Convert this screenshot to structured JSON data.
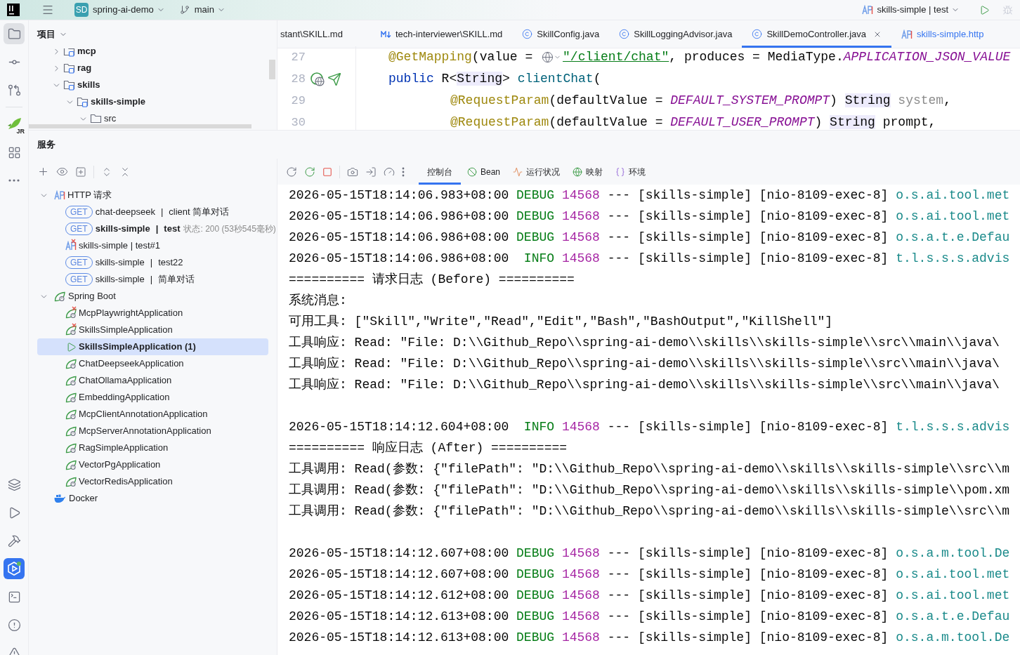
{
  "title_bar": {
    "project_badge": "SD",
    "project": "spring-ai-demo",
    "branch": "main",
    "run_config": "skills-simple | test"
  },
  "rail": {
    "top": [
      {
        "kind": "folder",
        "selected": true
      },
      {
        "kind": "commit",
        "selected": false
      },
      {
        "kind": "pull-request",
        "selected": false
      },
      {
        "kind": "rocket",
        "badge": "JR",
        "selected": false
      },
      {
        "kind": "structure",
        "selected": false
      },
      {
        "kind": "more",
        "selected": false
      }
    ],
    "bottom": [
      {
        "kind": "layers",
        "selected": false
      },
      {
        "kind": "run",
        "selected": false
      },
      {
        "kind": "build",
        "selected": false
      },
      {
        "kind": "services",
        "selected": true
      },
      {
        "kind": "terminal",
        "selected": false
      },
      {
        "kind": "problems",
        "selected": false
      },
      {
        "kind": "warning",
        "selected": false
      }
    ]
  },
  "project_panel": {
    "title": "项目",
    "tree": [
      {
        "label": "mcp",
        "kind": "module",
        "expanded": false
      },
      {
        "label": "rag",
        "kind": "module",
        "expanded": false
      },
      {
        "label": "skills",
        "kind": "module",
        "expanded": true,
        "children": [
          {
            "label": "skills-simple",
            "kind": "module",
            "expanded": true,
            "children": [
              {
                "label": "src",
                "kind": "folder",
                "expanded": true
              }
            ]
          }
        ]
      }
    ]
  },
  "editor": {
    "tabs": [
      {
        "label": "stant\\SKILL.md",
        "kind": "cut",
        "selected": false
      },
      {
        "label": "tech-interviewer\\SKILL.md",
        "kind": "markdown",
        "selected": false
      },
      {
        "label": "SkillConfig.java",
        "kind": "java",
        "selected": false
      },
      {
        "label": "SkillLoggingAdvisor.java",
        "kind": "java",
        "selected": false
      },
      {
        "label": "SkillDemoController.java",
        "kind": "java",
        "selected": true
      },
      {
        "label": "skills-simple.http",
        "kind": "http",
        "selected": false
      }
    ],
    "lines": [
      {
        "number": "27",
        "kind": "statement",
        "endpoint": false,
        "segments": [
          {
            "kind": "annotation",
            "text": "@GetMapping"
          },
          {
            "kind": "plain",
            "text": "(value = "
          },
          {
            "kind": "globe"
          },
          {
            "kind": "url",
            "text": "\"/client/chat\""
          },
          {
            "kind": "plain",
            "text": ", produces = MediaType."
          },
          {
            "kind": "constant",
            "text": "APPLICATION_JSON_VALUE"
          }
        ]
      },
      {
        "number": "28",
        "kind": "statement",
        "endpoint": true,
        "segments": [
          {
            "kind": "keyword",
            "text": "public"
          },
          {
            "kind": "plain",
            "text": " R<"
          },
          {
            "kind": "type",
            "text": "String"
          },
          {
            "kind": "plain",
            "text": "> "
          },
          {
            "kind": "function",
            "text": "clientChat"
          },
          {
            "kind": "plain",
            "text": "("
          }
        ]
      },
      {
        "number": "29",
        "kind": "continuation",
        "endpoint": false,
        "segments": [
          {
            "kind": "annotation",
            "text": "@RequestParam"
          },
          {
            "kind": "plain",
            "text": "(defaultValue = "
          },
          {
            "kind": "constant",
            "text": "DEFAULT_SYSTEM_PROMPT"
          },
          {
            "kind": "plain",
            "text": ") "
          },
          {
            "kind": "type",
            "text": "String"
          },
          {
            "kind": "param",
            "text": " system"
          },
          {
            "kind": "plain",
            "text": ","
          }
        ]
      },
      {
        "number": "30",
        "kind": "continuation",
        "endpoint": false,
        "segments": [
          {
            "kind": "annotation",
            "text": "@RequestParam"
          },
          {
            "kind": "plain",
            "text": "(defaultValue = "
          },
          {
            "kind": "constant",
            "text": "DEFAULT_USER_PROMPT"
          },
          {
            "kind": "plain",
            "text": ") "
          },
          {
            "kind": "type",
            "text": "String"
          },
          {
            "kind": "plain",
            "text": " prompt,"
          }
        ]
      }
    ]
  },
  "services": {
    "title": "服务",
    "tree": [
      {
        "kind": "http-group",
        "label": "HTTP 请求",
        "expanded": true,
        "selected": false,
        "children": [
          {
            "kind": "request",
            "method": "GET",
            "name": "chat-deepseek",
            "separator": "|",
            "desc": "client 简单对话",
            "bold": false,
            "selected": false
          },
          {
            "kind": "request",
            "method": "GET",
            "name": "skills-simple",
            "separator": "|",
            "desc": "test",
            "status": "状态: 200 (53秒545毫秒)",
            "bold": true,
            "selected": false
          },
          {
            "kind": "failed-request",
            "label": "skills-simple | test#1",
            "selected": false
          },
          {
            "kind": "request",
            "method": "GET",
            "name": "skills-simple",
            "separator": "|",
            "desc": "test22",
            "bold": false,
            "selected": false
          },
          {
            "kind": "request",
            "method": "GET",
            "name": "skills-simple",
            "separator": "|",
            "desc": "简单对话",
            "bold": false,
            "selected": false
          }
        ]
      },
      {
        "kind": "spring-group",
        "label": "Spring Boot",
        "expanded": true,
        "selected": false,
        "children": [
          {
            "kind": "app",
            "label": "McpPlaywrightApplication",
            "error": true,
            "running": false,
            "selected": false
          },
          {
            "kind": "app",
            "label": "SkillsSimpleApplication",
            "error": true,
            "running": false,
            "selected": false
          },
          {
            "kind": "app",
            "label": "SkillsSimpleApplication (1)",
            "error": false,
            "running": true,
            "selected": true
          },
          {
            "kind": "app",
            "label": "ChatDeepseekApplication",
            "error": false,
            "running": false,
            "selected": false
          },
          {
            "kind": "app",
            "label": "ChatOllamaApplication",
            "error": false,
            "running": false,
            "selected": false
          },
          {
            "kind": "app",
            "label": "EmbeddingApplication",
            "error": false,
            "running": false,
            "selected": false
          },
          {
            "kind": "app",
            "label": "McpClientAnnotationApplication",
            "error": false,
            "running": false,
            "selected": false
          },
          {
            "kind": "app",
            "label": "McpServerAnnotationApplication",
            "error": false,
            "running": false,
            "selected": false
          },
          {
            "kind": "app",
            "label": "RagSimpleApplication",
            "error": false,
            "running": false,
            "selected": false
          },
          {
            "kind": "app",
            "label": "VectorPgApplication",
            "error": false,
            "running": false,
            "selected": false
          },
          {
            "kind": "app",
            "label": "VectorRedisApplication",
            "error": false,
            "running": false,
            "selected": false
          }
        ]
      },
      {
        "kind": "docker",
        "label": "Docker",
        "selected": false
      }
    ],
    "console_tabs": [
      {
        "label": "控制台",
        "kind": "console",
        "selected": true
      },
      {
        "label": "Bean",
        "kind": "bean",
        "selected": false
      },
      {
        "label": "运行状况",
        "kind": "health",
        "selected": false
      },
      {
        "label": "映射",
        "kind": "mapping",
        "selected": false
      },
      {
        "label": "环境",
        "kind": "env",
        "selected": false
      }
    ],
    "console": [
      {
        "kind": "log",
        "time": "2026-05-15T18:14:06.983+08:00",
        "level": "DEBUG",
        "pid": "14568",
        "sep": "---",
        "app": "[skills-simple]",
        "thread": "[nio-8109-exec-8]",
        "logger": "o.s.ai.tool.met"
      },
      {
        "kind": "log",
        "time": "2026-05-15T18:14:06.986+08:00",
        "level": "DEBUG",
        "pid": "14568",
        "sep": "---",
        "app": "[skills-simple]",
        "thread": "[nio-8109-exec-8]",
        "logger": "o.s.ai.tool.met"
      },
      {
        "kind": "log",
        "time": "2026-05-15T18:14:06.986+08:00",
        "level": "DEBUG",
        "pid": "14568",
        "sep": "---",
        "app": "[skills-simple]",
        "thread": "[nio-8109-exec-8]",
        "logger": "o.s.a.t.e.Defau"
      },
      {
        "kind": "log",
        "time": "2026-05-15T18:14:06.986+08:00",
        "level": "INFO",
        "pid": "14568",
        "sep": "---",
        "app": "[skills-simple]",
        "thread": "[nio-8109-exec-8]",
        "logger": "t.l.s.s.s.advis"
      },
      {
        "kind": "text",
        "text": "========== 请求日志 (Before) =========="
      },
      {
        "kind": "text",
        "text": "系统消息:"
      },
      {
        "kind": "text",
        "text": "可用工具: [\"Skill\",\"Write\",\"Read\",\"Edit\",\"Bash\",\"BashOutput\",\"KillShell\"]"
      },
      {
        "kind": "text",
        "text": "工具响应: Read: \"File: D:\\\\Github_Repo\\\\spring-ai-demo\\\\skills\\\\skills-simple\\\\src\\\\main\\\\java\\"
      },
      {
        "kind": "text",
        "text": "工具响应: Read: \"File: D:\\\\Github_Repo\\\\spring-ai-demo\\\\skills\\\\skills-simple\\\\src\\\\main\\\\java\\"
      },
      {
        "kind": "text",
        "text": "工具响应: Read: \"File: D:\\\\Github_Repo\\\\spring-ai-demo\\\\skills\\\\skills-simple\\\\src\\\\main\\\\java\\"
      },
      {
        "kind": "blank"
      },
      {
        "kind": "log",
        "time": "2026-05-15T18:14:12.604+08:00",
        "level": "INFO",
        "pid": "14568",
        "sep": "---",
        "app": "[skills-simple]",
        "thread": "[nio-8109-exec-8]",
        "logger": "t.l.s.s.s.advis"
      },
      {
        "kind": "text",
        "text": "========== 响应日志 (After) =========="
      },
      {
        "kind": "text",
        "text": "工具调用: Read(参数: {\"filePath\": \"D:\\\\Github_Repo\\\\spring-ai-demo\\\\skills\\\\skills-simple\\\\src\\\\m"
      },
      {
        "kind": "text",
        "text": "工具调用: Read(参数: {\"filePath\": \"D:\\\\Github_Repo\\\\spring-ai-demo\\\\skills\\\\skills-simple\\\\pom.xm"
      },
      {
        "kind": "text",
        "text": "工具调用: Read(参数: {\"filePath\": \"D:\\\\Github_Repo\\\\spring-ai-demo\\\\skills\\\\skills-simple\\\\src\\\\m"
      },
      {
        "kind": "blank"
      },
      {
        "kind": "log",
        "time": "2026-05-15T18:14:12.607+08:00",
        "level": "DEBUG",
        "pid": "14568",
        "sep": "---",
        "app": "[skills-simple]",
        "thread": "[nio-8109-exec-8]",
        "logger": "o.s.a.m.tool.De"
      },
      {
        "kind": "log",
        "time": "2026-05-15T18:14:12.607+08:00",
        "level": "DEBUG",
        "pid": "14568",
        "sep": "---",
        "app": "[skills-simple]",
        "thread": "[nio-8109-exec-8]",
        "logger": "o.s.ai.tool.met"
      },
      {
        "kind": "log",
        "time": "2026-05-15T18:14:12.612+08:00",
        "level": "DEBUG",
        "pid": "14568",
        "sep": "---",
        "app": "[skills-simple]",
        "thread": "[nio-8109-exec-8]",
        "logger": "o.s.ai.tool.met"
      },
      {
        "kind": "log",
        "time": "2026-05-15T18:14:12.613+08:00",
        "level": "DEBUG",
        "pid": "14568",
        "sep": "---",
        "app": "[skills-simple]",
        "thread": "[nio-8109-exec-8]",
        "logger": "o.s.a.t.e.Defau"
      },
      {
        "kind": "log",
        "time": "2026-05-15T18:14:12.613+08:00",
        "level": "DEBUG",
        "pid": "14568",
        "sep": "---",
        "app": "[skills-simple]",
        "thread": "[nio-8109-exec-8]",
        "logger": "o.s.a.m.tool.De"
      }
    ]
  }
}
